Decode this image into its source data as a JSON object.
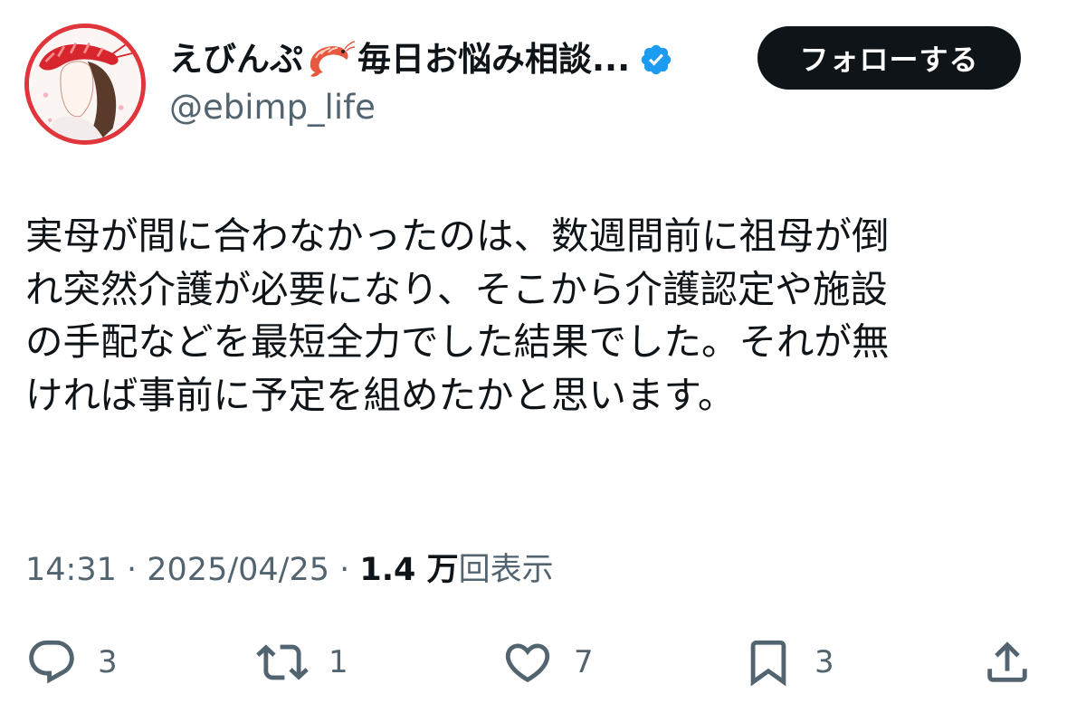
{
  "author": {
    "name_part1": "えびんぷ",
    "name_emoji": "shrimp-emoji",
    "name_part2": "毎日お悩み相談...",
    "handle": "@ebimp_life",
    "verified": true,
    "verified_color": "#1d9bf0",
    "avatar_border_color": "#e0353b"
  },
  "follow_button": {
    "label": "フォローする"
  },
  "tweet": {
    "lines": [
      "実母が間に合わなかったのは、数週間前に祖母が倒",
      "れ突然介護が必要になり、そこから介護認定や施設",
      "の手配などを最短全力でした結果でした。それが無",
      "ければ事前に予定を組めたかと思います。"
    ]
  },
  "meta": {
    "time": "14:31",
    "separator": " · ",
    "date": "2025/04/25",
    "views_count": "1.4 万",
    "views_label": "回表示"
  },
  "actions": {
    "reply": {
      "icon": "reply-icon",
      "count": "3"
    },
    "repost": {
      "icon": "repost-icon",
      "count": "1"
    },
    "like": {
      "icon": "heart-icon",
      "count": "7"
    },
    "bookmark": {
      "icon": "bookmark-icon",
      "count": "3"
    },
    "share": {
      "icon": "share-icon"
    }
  },
  "colors": {
    "text_primary": "#0f1419",
    "text_secondary": "#536471",
    "button_bg": "#0f1419"
  }
}
